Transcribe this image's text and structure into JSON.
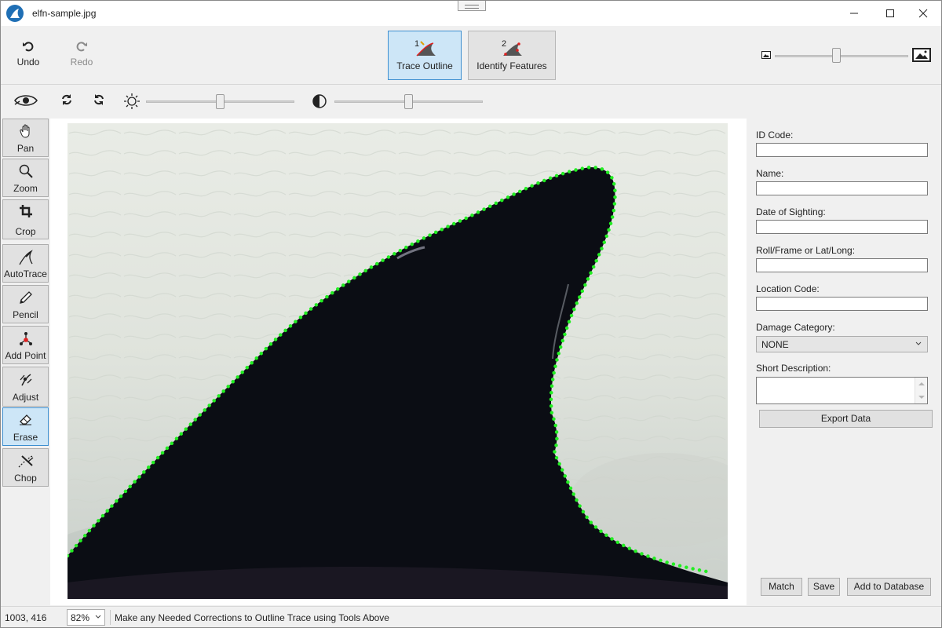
{
  "window": {
    "title": "elfn-sample.jpg",
    "controls": [
      "minimize",
      "maximize",
      "close"
    ]
  },
  "toolbar": {
    "undo_label": "Undo",
    "redo_label": "Redo",
    "steps": [
      {
        "number": "1",
        "label": "Trace Outline",
        "active": true
      },
      {
        "number": "2",
        "label": "Identify Features",
        "active": false
      }
    ],
    "zoom_slider_level": 0.46
  },
  "image_adjust": {
    "icons": [
      "eye-icon",
      "refresh-icon",
      "rotate-icon",
      "brightness-icon",
      "contrast-icon"
    ],
    "brightness_level": 0.5,
    "contrast_level": 0.5
  },
  "tools": [
    {
      "id": "pan",
      "label": "Pan",
      "icon": "hand-icon",
      "active": false
    },
    {
      "id": "zoom",
      "label": "Zoom",
      "icon": "magnifier-icon",
      "active": false
    },
    {
      "id": "crop",
      "label": "Crop",
      "icon": "crop-icon",
      "active": false
    },
    {
      "id": "autotrace",
      "label": "AutoTrace",
      "icon": "autotrace-icon",
      "active": false
    },
    {
      "id": "pencil",
      "label": "Pencil",
      "icon": "pencil-icon",
      "active": false
    },
    {
      "id": "add-point",
      "label": "Add Point",
      "icon": "add-point-icon",
      "active": false
    },
    {
      "id": "adjust",
      "label": "Adjust",
      "icon": "adjust-icon",
      "active": false
    },
    {
      "id": "erase",
      "label": "Erase",
      "icon": "eraser-icon",
      "active": true
    },
    {
      "id": "chop",
      "label": "Chop",
      "icon": "chop-icon",
      "active": false
    }
  ],
  "form": {
    "id_code_label": "ID Code:",
    "id_code_value": "",
    "name_label": "Name:",
    "name_value": "",
    "date_label": "Date of Sighting:",
    "date_value": "",
    "roll_label": "Roll/Frame or Lat/Long:",
    "roll_value": "",
    "location_label": "Location Code:",
    "location_value": "",
    "damage_label": "Damage Category:",
    "damage_value": "NONE",
    "description_label": "Short Description:",
    "description_value": "",
    "export_label": "Export Data",
    "match_label": "Match",
    "save_label": "Save",
    "add_db_label": "Add to Database"
  },
  "status": {
    "coords": "1003, 416",
    "zoom": "82%",
    "message": "Make any Needed Corrections to Outline Trace using Tools Above"
  },
  "colors": {
    "accent": "#3d8fd0",
    "active_bg": "#cde6f7",
    "trace": "#22ee22",
    "fin": "#0a0c12"
  }
}
